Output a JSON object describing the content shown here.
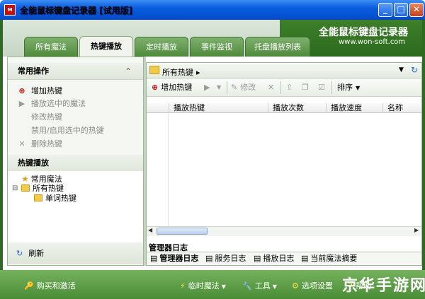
{
  "window": {
    "title": "全能鼠标键盘记录器 [试用版]",
    "app_icon_text": "M",
    "minimize": "_",
    "maximize": "□",
    "close": "✕"
  },
  "brand": {
    "title": "全能鼠标键盘记录器",
    "url": "www.won-soft.com"
  },
  "tabs": [
    {
      "label": "所有魔法"
    },
    {
      "label": "热键播放"
    },
    {
      "label": "定时播放"
    },
    {
      "label": "事件监视"
    },
    {
      "label": "托盘播放列表"
    }
  ],
  "left": {
    "common_ops_title": "常用操作",
    "collapse_icon": "⌃",
    "actions": [
      {
        "label": "增加热键",
        "icon": "add-icon"
      },
      {
        "label": "播放选中的魔法",
        "icon": "play-icon"
      },
      {
        "label": "修改热键",
        "icon": ""
      },
      {
        "label": "禁用/启用选中的热键",
        "icon": ""
      },
      {
        "label": "删除热键",
        "icon": "delete-icon"
      }
    ],
    "hotkey_section_title": "热键播放",
    "tree": {
      "common_magic": "常用魔法",
      "expand_symbol": "⊟",
      "all_hotkeys": "所有热键",
      "word_hotkeys": "单词热键"
    },
    "refresh_label": "刷新"
  },
  "right": {
    "breadcrumb": "所有热键",
    "toolbar": {
      "add": "增加热键",
      "edit": "修改",
      "sort": "排序"
    },
    "columns": [
      "播放热键",
      "播放次数",
      "播放速度",
      "名称"
    ],
    "rows": [],
    "log_title": "管理器日志",
    "log_tabs": [
      "管理器日志",
      "服务日志",
      "播放日志",
      "当前魔法摘要"
    ]
  },
  "bottom": {
    "buy": "购买和激活",
    "temp_magic": "临时魔法",
    "tools": "工具",
    "options": "选项设置",
    "help": "帮助",
    "watermark": "京华手游网"
  }
}
